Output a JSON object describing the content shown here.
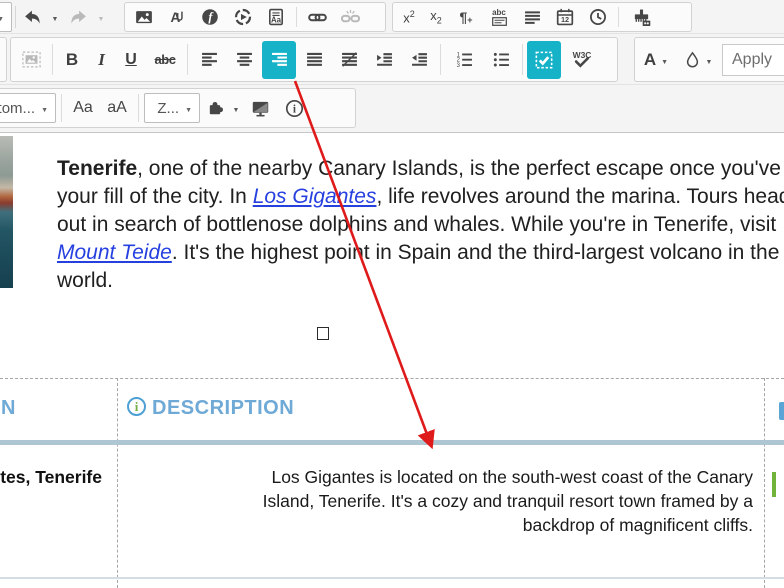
{
  "app": {
    "type": "rich text editor with annotation"
  },
  "colors": {
    "toolbar_accent": "#15b2c8",
    "annotation_arrow": "#df1a1a",
    "table_header_text": "#6fa9d6",
    "table_header_icon_ring": "#4da0d4",
    "table_header_icon_letter": "#76b043",
    "link_blue": "#2640e0",
    "table_divider_strong": "#aec6d1",
    "table_divider_light": "#d3dee4"
  },
  "toolbar": {
    "labels": {
      "bold": "B",
      "italic": "I",
      "underline": "U",
      "strikethrough": "abc",
      "superscript_base": "x",
      "superscript_exp": "2",
      "subscript_base": "x",
      "subscript_sub": "2",
      "paragraph_mark": "¶",
      "paragraph_plus": "+",
      "abc_small": "abc",
      "calendar_day": "12",
      "w3c": "W3C",
      "font_color": "A",
      "capitalize": "Aa",
      "lowercase": "aA",
      "styles_combo_visible": "stom...",
      "zoom_combo_visible": "Z...",
      "apply_style": "Apply"
    },
    "states": {
      "align_right": "active",
      "show_blocks": "active",
      "redo": "disabled",
      "unlink": "disabled",
      "placeholder_image": "disabled"
    },
    "icons": {
      "row1": [
        "chevron-down",
        "undo",
        "chevron-down",
        "redo",
        "chevron-down",
        "image",
        "anchor-text",
        "flash",
        "media-embed",
        "document-aa",
        "link",
        "unlink",
        "superscript",
        "subscript",
        "paragraph-insert",
        "abc-block",
        "line-spacing",
        "calendar-12",
        "clock",
        "format-brush"
      ],
      "row2": [
        "placeholder-image",
        "bold",
        "italic",
        "underline",
        "strikethrough",
        "align-left",
        "align-center",
        "align-right",
        "justify",
        "align-none",
        "indent",
        "outdent",
        "numbered-list",
        "bulleted-list",
        "show-blocks",
        "w3c-validate",
        "font-color",
        "highlight-droplet",
        "apply-style-box"
      ],
      "row3": [
        "styles-combo",
        "capitalize",
        "lowercase",
        "zoom-combo",
        "puzzle-plugin",
        "chevron-down",
        "preview-screen",
        "info-circle"
      ]
    }
  },
  "document": {
    "paragraph": {
      "lines": [
        [
          {
            "text": "Tenerife",
            "bold": true
          },
          {
            "text": ", one of the nearby Canary Islands, is the perfect escape once you've had"
          }
        ],
        [
          {
            "text": "your fill of the city. In "
          },
          {
            "text": "Los Gigantes",
            "link": true
          },
          {
            "text": ", life revolves around the marina. Tours head out"
          }
        ],
        [
          {
            "text": "out in search of bottlenose dolphins and whales. While you're in Tenerife, visit"
          }
        ],
        [
          {
            "text": "Mount Teide",
            "link": true
          },
          {
            "text": ". It's the highest point in Spain and the third-largest volcano in the"
          }
        ],
        [
          {
            "text": "world."
          }
        ]
      ]
    },
    "placeholder_marker": "□"
  },
  "table": {
    "header": {
      "col1": "LOCATION",
      "col2": "DESCRIPTION"
    },
    "row": {
      "col1": "Los Gigantes, Tenerife",
      "description_lines": [
        "Los Gigantes is located on the south-west coast of the Canary",
        "Island, Tenerife. It's a cozy and tranquil resort town framed by a",
        "backdrop of magnificent cliffs."
      ]
    }
  },
  "annotation": {
    "arrow_color": "#df1a1a",
    "from": "align-right-button",
    "to": "description-cell"
  }
}
